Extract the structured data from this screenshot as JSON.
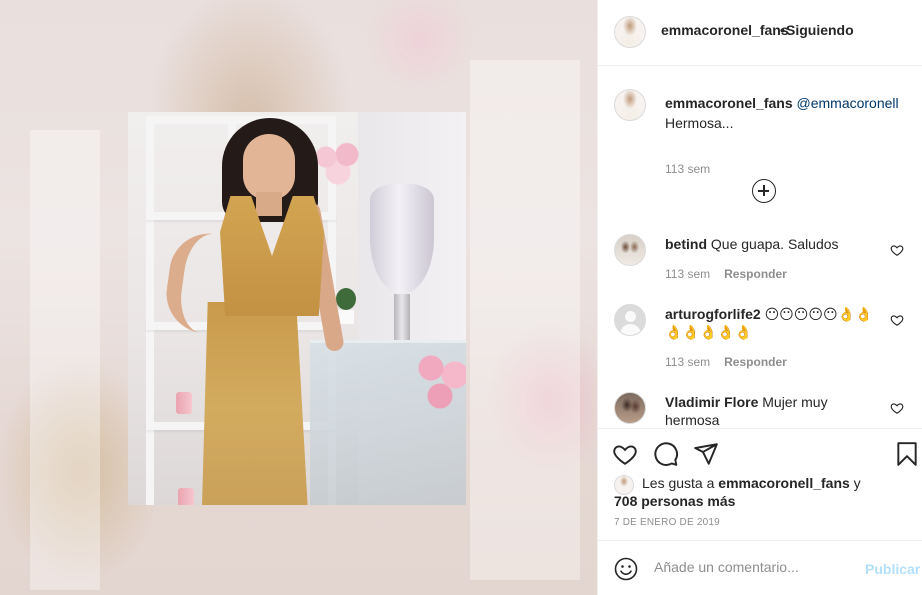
{
  "post": {
    "username": "emmacoronel_fans",
    "separator": "•",
    "follow_status": "Siguiendo",
    "caption": {
      "username": "emmacoronel_fans",
      "mention": "@emmacoronell",
      "text": "Hermosa...",
      "time": "113 sem"
    },
    "comments": [
      {
        "username": "betind",
        "text": "Que guapa. Saludos",
        "time": "113 sem",
        "reply": "Responder"
      },
      {
        "username": "arturogforlife2",
        "text": "😶😶😶😶😶👌👌👌👌👌👌👌",
        "time": "113 sem",
        "reply": "Responder"
      },
      {
        "username": "Vladimir Flore",
        "text": "Mujer muy hermosa"
      }
    ],
    "likes": {
      "prefix": "Les gusta a",
      "user": "emmacoronell_fans",
      "and": "y",
      "others": "708 personas más"
    },
    "date": "7 DE ENERO DE 2019",
    "add_comment": {
      "placeholder": "Añade un comentario...",
      "post_button": "Publicar"
    }
  },
  "icons": [
    "heart-icon",
    "comment-icon",
    "share-icon",
    "bookmark-icon",
    "emoji-icon",
    "load-more-icon"
  ],
  "colors": {
    "text": "#262626",
    "secondary": "#8e8e8e",
    "link": "#00376b",
    "post_disabled": "#b2dffc",
    "border": "#efefef"
  }
}
